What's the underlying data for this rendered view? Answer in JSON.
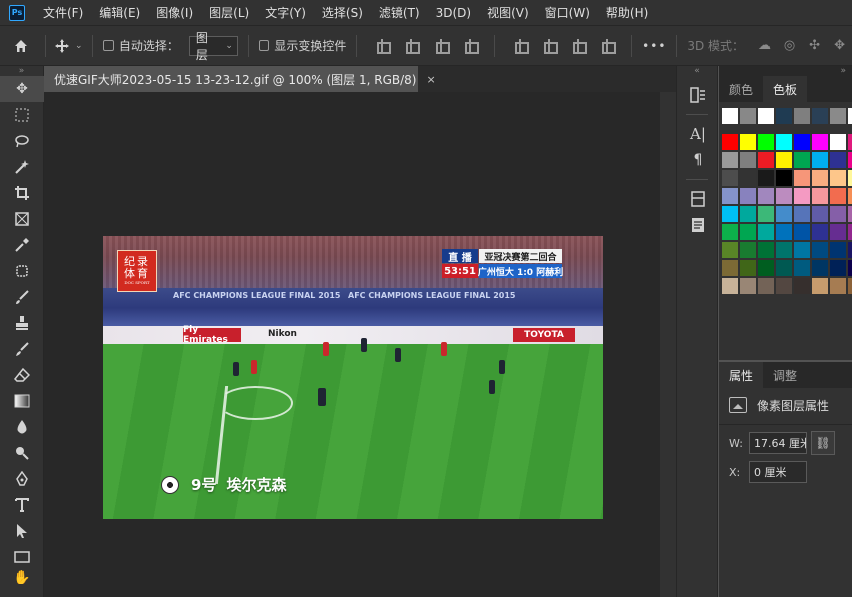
{
  "app": {
    "logo": "Ps"
  },
  "menu": [
    "文件(F)",
    "编辑(E)",
    "图像(I)",
    "图层(L)",
    "文字(Y)",
    "选择(S)",
    "滤镜(T)",
    "3D(D)",
    "视图(V)",
    "窗口(W)",
    "帮助(H)"
  ],
  "options": {
    "auto_select_label": "自动选择：",
    "auto_select_value": "图层",
    "show_transform_label": "显示变换控件",
    "more_label": "•••",
    "mode_3d_label": "3D 模式："
  },
  "document": {
    "tab_title": "优速GIF大师2023-05-15 13-23-12.gif @ 100% (图层 1, RGB/8)",
    "close_glyph": "×"
  },
  "image": {
    "logo_line1": "纪录",
    "logo_line2": "体育",
    "logo_line3": "DOC SPORT",
    "live_label": "直 播",
    "match_title": "亚冠决赛第二回合",
    "clock": "53:51",
    "score_line": "广州恒大 1:0 阿赫利",
    "ad_fly": "Fly Emirates",
    "ad_nikon": "Nikon",
    "ad_toyota": "TOYOTA",
    "banner_text": "AFC CHAMPIONS LEAGUE FINAL 2015",
    "caption_number": "9号",
    "caption_name": "埃尔克森"
  },
  "panels": {
    "swatches_tabs": [
      "颜色",
      "色板"
    ],
    "swatches_active": "色板",
    "properties_tabs": [
      "属性",
      "调整"
    ],
    "properties_active": "属性",
    "pixel_layer_label": "像素图层属性",
    "w_label": "W:",
    "w_value": "17.64 厘米",
    "x_label": "X:",
    "x_value": "0 厘米"
  },
  "colors": {
    "swatch_rows": [
      [
        "#ffffff",
        "#888888",
        "#ffffff",
        "#1f3b52",
        "#7f7f7f",
        "#2a4056",
        "#8a8a8a",
        "#ffffff"
      ],
      [
        "#ff0000",
        "#ffff00",
        "#00ff00",
        "#00ffff",
        "#0000ff",
        "#ff00ff",
        "#ffffff",
        "#e0197d"
      ],
      [
        "#9a9a9a",
        "#7f7f7f",
        "#ec1c24",
        "#fff200",
        "#00a651",
        "#00aeef",
        "#2e3192",
        "#ec008c"
      ],
      [
        "#4d4d4d",
        "#333333",
        "#1a1a1a",
        "#000000",
        "#f69679",
        "#f9ad81",
        "#fdc68a",
        "#fff79a"
      ],
      [
        "#8493ca",
        "#8882be",
        "#a187be",
        "#bc8cbf",
        "#f49ac2",
        "#f6989d",
        "#f26c4f",
        "#f68e55"
      ],
      [
        "#00bff3",
        "#00a99d",
        "#3cb878",
        "#448ccb",
        "#5674b9",
        "#605ca8",
        "#855fa8",
        "#a864a8"
      ],
      [
        "#0db14b",
        "#00a651",
        "#00a99d",
        "#0072bc",
        "#0054a6",
        "#2e3192",
        "#662d91",
        "#92278f"
      ],
      [
        "#598527",
        "#197b30",
        "#007236",
        "#00746b",
        "#0076a3",
        "#004a80",
        "#003471",
        "#1b1464"
      ],
      [
        "#7c6a35",
        "#406618",
        "#005e20",
        "#005952",
        "#005b7f",
        "#003663",
        "#002157",
        "#0d004c"
      ],
      [
        "#c7b299",
        "#998675",
        "#736357",
        "#534741",
        "#362f2d",
        "#c69c6d",
        "#a67c52",
        "#8c6239"
      ]
    ]
  }
}
